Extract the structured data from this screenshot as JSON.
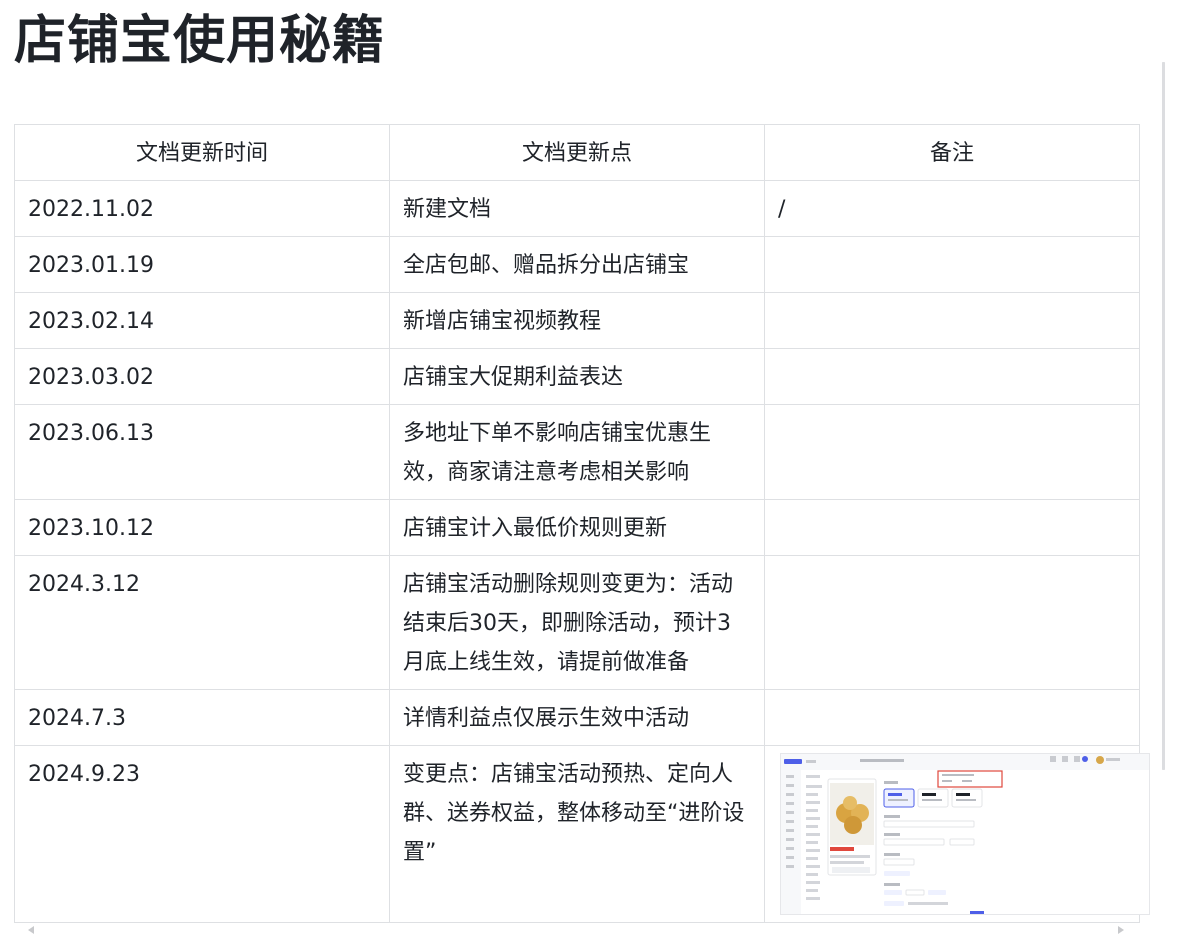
{
  "title": "店铺宝使用秘籍",
  "table": {
    "headers": [
      "文档更新时间",
      "文档更新点",
      "备注"
    ],
    "rows": [
      {
        "time": "2022.11.02",
        "point": "新建文档",
        "note": "/"
      },
      {
        "time": "2023.01.19",
        "point": "全店包邮、赠品拆分出店铺宝",
        "note": ""
      },
      {
        "time": "2023.02.14",
        "point": "新增店铺宝视频教程",
        "note": ""
      },
      {
        "time": "2023.03.02",
        "point": "店铺宝大促期利益表达",
        "note": ""
      },
      {
        "time": "2023.06.13",
        "point": "多地址下单不影响店铺宝优惠生效，商家请注意考虑相关影响",
        "note": ""
      },
      {
        "time": "2023.10.12",
        "point": "店铺宝计入最低价规则更新",
        "note": ""
      },
      {
        "time": "2024.3.12",
        "point": "店铺宝活动删除规则变更为：活动结束后30天，即删除活动，预计3月底上线生效，请提前做准备",
        "note": ""
      },
      {
        "time": "2024.7.3",
        "point": "详情利益点仅展示生效中活动",
        "note": ""
      },
      {
        "time": "2024.9.23",
        "point": "变更点：店铺宝活动预热、定向人群、送券权益，整体移动至“进阶设置”",
        "note": ""
      }
    ]
  },
  "colors": {
    "border": "#dee0e3",
    "text": "#1f2329",
    "accent": "#4e5fe8",
    "highlight_box": "#e0483d"
  },
  "remark_image_icon": "screenshot-thumbnail"
}
